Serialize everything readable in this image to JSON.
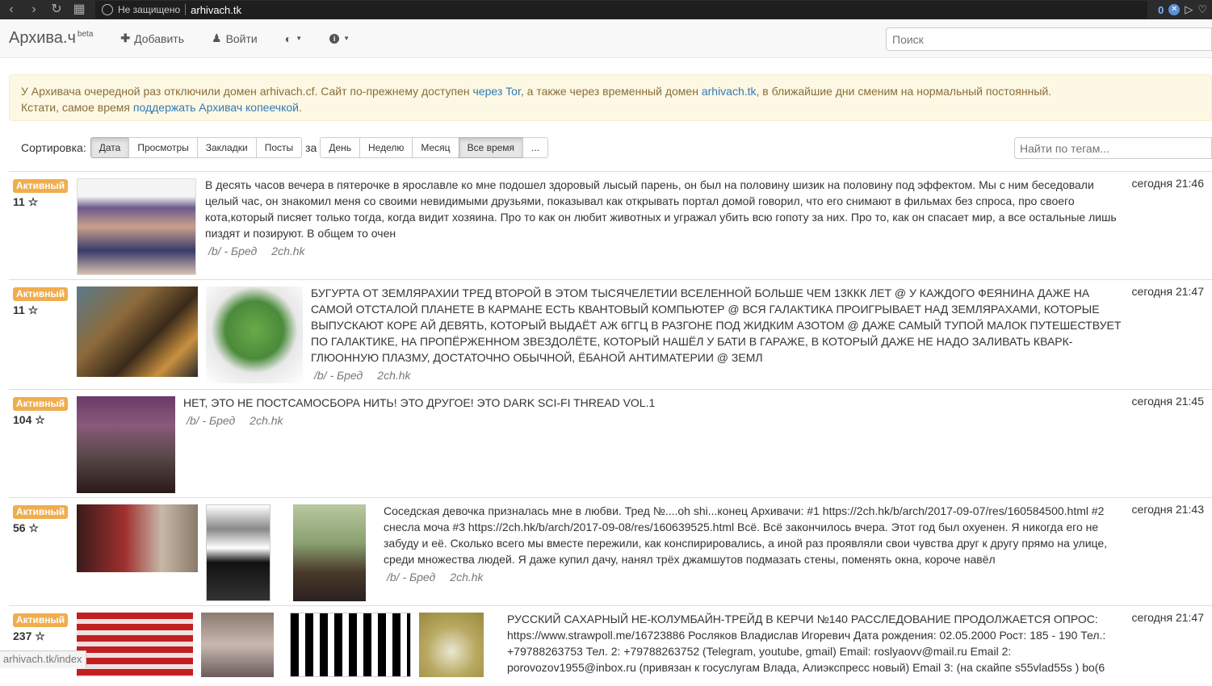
{
  "browser": {
    "insecure_label": "Не защищено",
    "url": "arhivach.tk",
    "count": "0"
  },
  "navbar": {
    "brand": "Архива.ч",
    "brand_sup": "beta",
    "add": "Добавить",
    "login": "Войти",
    "search_placeholder": "Поиск"
  },
  "alert": {
    "p1": "У Архивача очередной раз отключили домен arhivach.cf. Сайт по-прежнему доступен ",
    "link_tor": "через Tor",
    "p2": ", а также через временный домен ",
    "link_domain": "arhivach.tk",
    "p3": ", в ближайшие дни сменим на нормальный постоянный.",
    "p4": "Кстати, самое время ",
    "link_donate": "поддержать Архивач копеечкой",
    "p5": "."
  },
  "sort": {
    "label": "Сортировка:",
    "by": [
      "Дата",
      "Просмотры",
      "Закладки",
      "Посты"
    ],
    "za": "за",
    "period": [
      "День",
      "Неделю",
      "Месяц",
      "Все время",
      "..."
    ],
    "tag_placeholder": "Найти по тегам..."
  },
  "threads": [
    {
      "label": "Активный",
      "rating": "11 ☆",
      "text": "В десять часов вечера в пятерочке в ярославле ко мне подошел здоровый лысый парень, он был на половину шизик на половину под эффектом. Мы с ним беседовали целый час, он знакомил меня со своими невидимыми друзьями, показывал как открывать портал домой говорил, что его снимают в фильмах без спроса, про своего кота,который писяет только тогда, когда видит хозяина. Про то как он любит животных и угражал убить всю гопоту за них. Про то, как он спасает мир, а все остальные лишь пиздят и позируют. В общем то очен",
      "board": "/b/ - Бред",
      "host": "2ch.hk",
      "time": "сегодня 21:46"
    },
    {
      "label": "Активный",
      "rating": "11 ☆",
      "text": "БУГУРТА ОТ ЗЕМЛЯРАХИИ ТРЕД ВТОРОЙ В ЭТОМ ТЫСЯЧЕЛЕТИИ ВСЕЛЕННОЙ БОЛЬШЕ ЧЕМ 13ККК ЛЕТ @ У КАЖДОГО ФЕЯНИНА ДАЖЕ НА САМОЙ ОТСТАЛОЙ ПЛАНЕТЕ В КАРМАНЕ ЕСТЬ КВАНТОВЫЙ КОМПЬЮТЕР @ ВСЯ ГАЛАКТИКА ПРОИГРЫВАЕТ НАД ЗЕМЛЯРАХАМИ, КОТОРЫЕ ВЫПУСКАЮТ КОРЕ АЙ ДЕВЯТЬ, КОТОРЫЙ ВЫДАЁТ АЖ 6ГГЦ В РАЗГОНЕ ПОД ЖИДКИМ АЗОТОМ @ ДАЖЕ САМЫЙ ТУПОЙ МАЛОК ПУТЕШЕСТВУЕТ ПО ГАЛАКТИКЕ, НА ПРОПЁРЖЕННОМ ЗВЕЗДОЛЁТЕ, КОТОРЫЙ НАШЁЛ У БАТИ В ГАРАЖЕ, В КОТОРЫЙ ДАЖЕ НЕ НАДО ЗАЛИВАТЬ КВАРК-ГЛЮОННУЮ ПЛАЗМУ, ДОСТАТОЧНО ОБЫЧНОЙ, ЁБАНОЙ АНТИМАТЕРИИ @ ЗЕМЛ",
      "board": "/b/ - Бред",
      "host": "2ch.hk",
      "time": "сегодня 21:47"
    },
    {
      "label": "Активный",
      "rating": "104 ☆",
      "text": "НЕТ, ЭТО НЕ ПОСТСАМОСБОРА НИТЬ! ЭТО ДРУГОЕ! ЭТО DARK SCI-FI THREAD VOL.1",
      "board": "/b/ - Бред",
      "host": "2ch.hk",
      "time": "сегодня 21:45"
    },
    {
      "label": "Активный",
      "rating": "56 ☆",
      "text": "Соседская девочка призналась мне в любви. Тред №....oh shi...конец Архивачи: #1 https://2ch.hk/b/arch/2017-09-07/res/160584500.html #2 снесла моча #3 https://2ch.hk/b/arch/2017-09-08/res/160639525.html Всё. Всё закончилось вчера. Этот год был охуенен. Я никогда его не забуду и её. Сколько всего мы вместе пережили, как конспирировались, а иной раз проявляли свои чувства друг к другу прямо на улице, среди множества людей. Я даже купил дачу, нанял трёх джамшутов подмазать стены, поменять окна, короче навёл",
      "board": "/b/ - Бред",
      "host": "2ch.hk",
      "time": "сегодня 21:43"
    },
    {
      "label": "Активный",
      "rating": "237 ☆",
      "text": "РУССКИЙ САХАРНЫЙ НЕ-КОЛУМБАЙН-ТРЕЙД В КЕРЧИ №140 РАССЛЕДОВАНИЕ ПРОДОЛЖАЕТСЯ ОПРОС: https://www.strawpoll.me/16723886 Росляков Владислав Игоревич Дата рождения: 02.05.2000 Рост: 185 - 190 Тел.: +79788263753 Тел. 2: +79788263752 (Telegram, youtube, gmail) Email: roslyaovv@mail.ru Email 2: porovozov1955@inbox.ru (привязан к госуслугам Влада, Алиэкспресс новый) Email 3: (на скайпе s55vlad55s ) bo(6",
      "board": "/b/ - Бред",
      "host": "2ch.hk",
      "time": "сегодня 21:47"
    }
  ],
  "status_url": "arhivach.tk/index"
}
